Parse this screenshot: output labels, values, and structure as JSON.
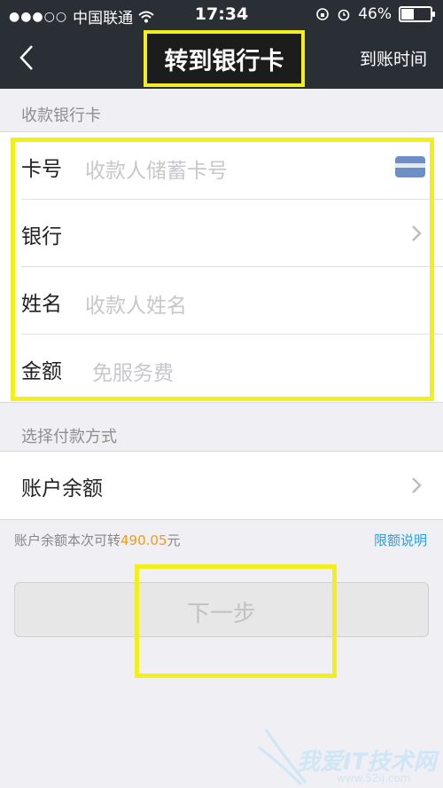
{
  "status_bar": {
    "carrier": "中国联通",
    "time": "17:34",
    "battery": "46%",
    "battery_level": 0.46
  },
  "nav": {
    "title": "转到银行卡",
    "right_label": "到账时间"
  },
  "recipient_section": {
    "title": "收款银行卡",
    "rows": [
      {
        "label": "卡号",
        "placeholder": "收款人储蓄卡号"
      },
      {
        "label": "银行",
        "placeholder": ""
      },
      {
        "label": "姓名",
        "placeholder": "收款人姓名"
      },
      {
        "label": "金额",
        "placeholder": "免服务费"
      }
    ]
  },
  "payment_section": {
    "title": "选择付款方式",
    "method": "账户余额"
  },
  "balance_info": {
    "prefix": "账户余额本次可转",
    "amount": "490.05",
    "suffix": "元",
    "limit_link": "限额说明"
  },
  "next_button": {
    "label": "下一步"
  },
  "watermark": {
    "text": "我爱IT技术网",
    "sub": "www.52ij.com"
  },
  "colors": {
    "nav_bg": "#2a2f35",
    "highlight": "#f3ef1c",
    "amount": "#f39a1a",
    "link": "#2f9fd7"
  }
}
